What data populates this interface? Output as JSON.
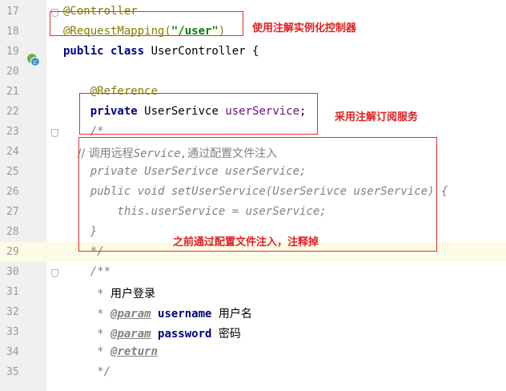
{
  "editor": {
    "lines": [
      {
        "n": "17",
        "parts": [
          {
            "t": "@Controller",
            "c": "ann"
          }
        ]
      },
      {
        "n": "18",
        "parts": [
          {
            "t": "@RequestMapping(",
            "c": "ann"
          },
          {
            "t": "\"/user\"",
            "c": "str"
          },
          {
            "t": ")",
            "c": "ann"
          }
        ]
      },
      {
        "n": "19",
        "parts": [
          {
            "t": "public class ",
            "c": "kw"
          },
          {
            "t": "UserController {",
            "c": "plain"
          }
        ]
      },
      {
        "n": "20",
        "parts": []
      },
      {
        "n": "21",
        "parts": [
          {
            "t": "    @Reference",
            "c": "ann"
          }
        ]
      },
      {
        "n": "22",
        "parts": [
          {
            "t": "    private ",
            "c": "kw"
          },
          {
            "t": "UserSerivce ",
            "c": "plain"
          },
          {
            "t": "userService",
            "c": "ivar"
          },
          {
            "t": ";",
            "c": "plain"
          }
        ]
      },
      {
        "n": "23",
        "parts": [
          {
            "t": "    /*",
            "c": "cm"
          }
        ]
      },
      {
        "n": "24",
        "parts": [
          {
            "t": "    // 调用远程",
            "c": "cm cn"
          },
          {
            "t": "Service,",
            "c": "cm"
          },
          {
            "t": "通过配置文件注入",
            "c": "cm cn"
          }
        ]
      },
      {
        "n": "25",
        "parts": [
          {
            "t": "    private UserSerivce userService;",
            "c": "cm"
          }
        ]
      },
      {
        "n": "26",
        "parts": [
          {
            "t": "    public void setUserService(UserSerivce userService) {",
            "c": "cm"
          }
        ]
      },
      {
        "n": "27",
        "parts": [
          {
            "t": "        this.userService = userService;",
            "c": "cm"
          }
        ]
      },
      {
        "n": "28",
        "parts": [
          {
            "t": "    }",
            "c": "cm"
          }
        ]
      },
      {
        "n": "29",
        "parts": [
          {
            "t": "    */",
            "c": "cm"
          }
        ]
      },
      {
        "n": "30",
        "parts": [
          {
            "t": "    /**",
            "c": "cm"
          }
        ]
      },
      {
        "n": "31",
        "parts": [
          {
            "t": "     * ",
            "c": "jd"
          },
          {
            "t": "用户登录",
            "c": "jd cn plain"
          }
        ]
      },
      {
        "n": "32",
        "parts": [
          {
            "t": "     * ",
            "c": "jd"
          },
          {
            "t": "@param",
            "c": "tag"
          },
          {
            "t": " username ",
            "c": "kw"
          },
          {
            "t": "用户名",
            "c": "plain cn"
          }
        ]
      },
      {
        "n": "33",
        "parts": [
          {
            "t": "     * ",
            "c": "jd"
          },
          {
            "t": "@param",
            "c": "tag"
          },
          {
            "t": " password ",
            "c": "kw"
          },
          {
            "t": "密码",
            "c": "plain cn"
          }
        ]
      },
      {
        "n": "34",
        "parts": [
          {
            "t": "     * ",
            "c": "jd"
          },
          {
            "t": "@return",
            "c": "tag"
          }
        ]
      },
      {
        "n": "35",
        "parts": [
          {
            "t": "     */",
            "c": "cm"
          }
        ]
      }
    ]
  },
  "annotations": {
    "controller_note": "使用注解实例化控制器",
    "reference_note": "采用注解订阅服务",
    "commented_note": "之前通过配置文件注入，注释掉"
  },
  "colors": {
    "annotation_red": "#e02020",
    "keyword": "#000080",
    "annotation": "#808000",
    "comment": "#808080"
  }
}
